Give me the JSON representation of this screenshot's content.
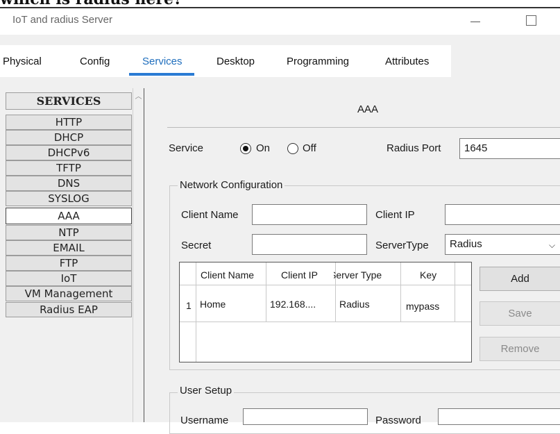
{
  "caption": "which is radius here?",
  "window": {
    "title": "IoT and radius Server"
  },
  "tabs": [
    {
      "label": "Physical"
    },
    {
      "label": "Config"
    },
    {
      "label": "Services"
    },
    {
      "label": "Desktop"
    },
    {
      "label": "Programming"
    },
    {
      "label": "Attributes"
    }
  ],
  "active_tab": "Services",
  "services": {
    "header": "SERVICES",
    "items": [
      "HTTP",
      "DHCP",
      "DHCPv6",
      "TFTP",
      "DNS",
      "SYSLOG",
      "AAA",
      "NTP",
      "EMAIL",
      "FTP",
      "IoT",
      "VM Management",
      "Radius EAP"
    ],
    "selected": "AAA"
  },
  "aaa": {
    "title": "AAA",
    "service_label": "Service",
    "on_label": "On",
    "off_label": "Off",
    "service_state": "On",
    "radius_port_label": "Radius Port",
    "radius_port_value": "1645",
    "network_config": {
      "title": "Network Configuration",
      "client_name_label": "Client Name",
      "client_name_value": "",
      "client_ip_label": "Client IP",
      "client_ip_value": "",
      "secret_label": "Secret",
      "secret_value": "",
      "server_type_label": "ServerType",
      "server_type_value": "Radius",
      "columns": [
        "Client Name",
        "Client IP",
        "Server Type",
        "Key"
      ],
      "rows": [
        {
          "index": "1",
          "client_name": "Home",
          "client_ip": "192.168....",
          "server_type": "Radius",
          "key": "mypass"
        }
      ],
      "add_label": "Add",
      "save_label": "Save",
      "remove_label": "Remove"
    },
    "user_setup": {
      "title": "User Setup",
      "username_label": "Username",
      "password_label": "Password"
    }
  }
}
